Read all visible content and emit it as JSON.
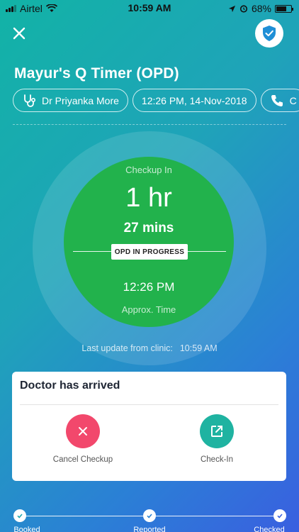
{
  "status_bar": {
    "carrier": "Airtel",
    "time": "10:59 AM",
    "battery": "68%"
  },
  "header": {
    "title": "Mayur's Q Timer (OPD)"
  },
  "chips": [
    {
      "icon": "stethoscope-icon",
      "label": "Dr Priyanka More"
    },
    {
      "icon": "",
      "label": "12:26 PM, 14-Nov-2018"
    },
    {
      "icon": "phone-icon",
      "label": "C"
    }
  ],
  "timer": {
    "checkup_in_label": "Checkup In",
    "hours": "1 hr",
    "mins": "27 mins",
    "status_badge": "OPD IN PROGRESS",
    "approx_time": "12:26 PM",
    "approx_label": "Approx. Time"
  },
  "last_update": {
    "label": "Last update from clinic:",
    "time": "10:59 AM"
  },
  "card": {
    "title": "Doctor has arrived",
    "cancel_label": "Cancel Checkup",
    "checkin_label": "Check-In"
  },
  "steps": [
    {
      "label": "Booked"
    },
    {
      "label": "Reported"
    },
    {
      "label": "Checked"
    }
  ],
  "colors": {
    "timer_green": "#22b24c",
    "cancel_red": "#f2486c",
    "checkin_teal": "#1fb3a1",
    "gradient_start": "#12b3a6",
    "gradient_end": "#3a5fe0"
  }
}
